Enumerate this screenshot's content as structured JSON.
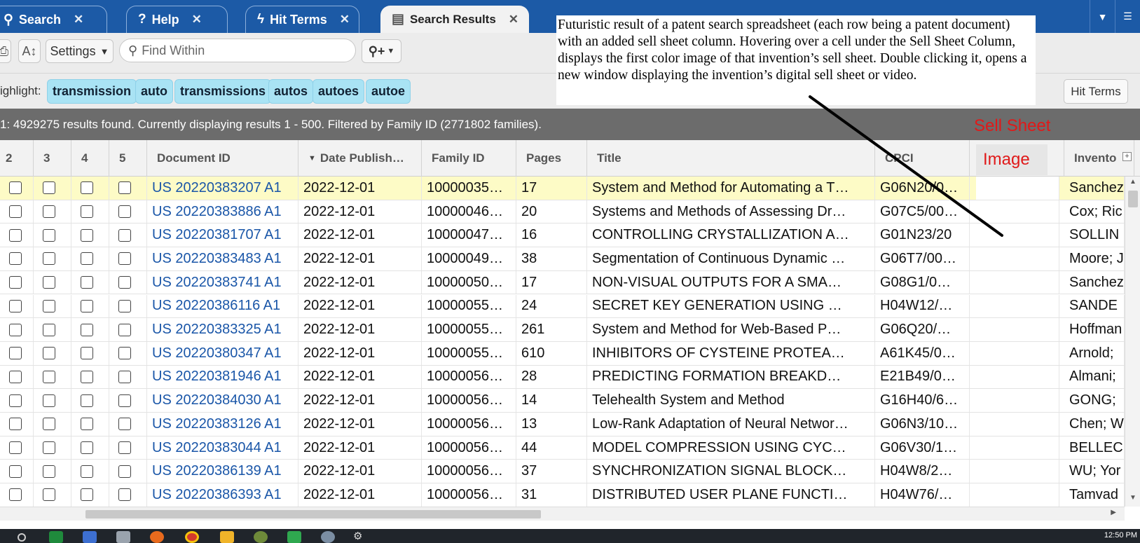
{
  "tabs": [
    {
      "label": "Search",
      "icon": "search-icon"
    },
    {
      "label": "Help",
      "icon": "help-icon"
    },
    {
      "label": "Hit Terms",
      "icon": "lightning-icon"
    },
    {
      "label": "Search Results",
      "icon": "results-icon",
      "active": true
    }
  ],
  "toolbar": {
    "settings_label": "Settings",
    "find_within_placeholder": "Find Within"
  },
  "highlight": {
    "label": "ighlight:",
    "terms": [
      "transmission",
      "auto",
      "transmissions",
      "autos",
      "autoes",
      "autoe"
    ],
    "hit_terms_button": "Hit Terms"
  },
  "status": {
    "text": "1: 4929275 results found. Currently displaying results 1 - 500. Filtered by Family ID (2771802 families)."
  },
  "annotation": {
    "text": "Futuristic result of a patent search spreadsheet (each row being a patent document) with an added sell sheet column. Hovering over a cell under the Sell Sheet Column, displays the first color image of that invention’s sell sheet.  Double clicking it, opens a new window displaying the invention’s digital sell sheet or video.",
    "sell_sheet_label": "Sell Sheet",
    "image_label": "Image"
  },
  "grid": {
    "columns": [
      "2",
      "3",
      "4",
      "5",
      "Document ID",
      "Date Publish…",
      "Family ID",
      "Pages",
      "Title",
      "CPCI",
      "",
      "Invento"
    ],
    "rows": [
      {
        "doc": "US 20220383207 A1",
        "date": "2022-12-01",
        "family": "10000035…",
        "pages": "17",
        "title": "System and Method for Automating a T…",
        "cpci": "G06N20/0…",
        "inventor": "Sanchez"
      },
      {
        "doc": "US 20220383886 A1",
        "date": "2022-12-01",
        "family": "10000046…",
        "pages": "20",
        "title": "Systems and Methods of Assessing Dr…",
        "cpci": "G07C5/00…",
        "inventor": "Cox; Ric"
      },
      {
        "doc": "US 20220381707 A1",
        "date": "2022-12-01",
        "family": "10000047…",
        "pages": "16",
        "title": "CONTROLLING CRYSTALLIZATION A…",
        "cpci": "G01N23/20",
        "inventor": "SOLLIN"
      },
      {
        "doc": "US 20220383483 A1",
        "date": "2022-12-01",
        "family": "10000049…",
        "pages": "38",
        "title": "Segmentation of Continuous Dynamic …",
        "cpci": "G06T7/00…",
        "inventor": "Moore; J"
      },
      {
        "doc": "US 20220383741 A1",
        "date": "2022-12-01",
        "family": "10000050…",
        "pages": "17",
        "title": "NON-VISUAL OUTPUTS FOR A SMA…",
        "cpci": "G08G1/0…",
        "inventor": "Sanchez"
      },
      {
        "doc": "US 20220386116 A1",
        "date": "2022-12-01",
        "family": "10000055…",
        "pages": "24",
        "title": "SECRET KEY GENERATION USING …",
        "cpci": "H04W12/…",
        "inventor": "SANDE"
      },
      {
        "doc": "US 20220383325 A1",
        "date": "2022-12-01",
        "family": "10000055…",
        "pages": "261",
        "title": "System and Method for Web-Based P…",
        "cpci": "G06Q20/…",
        "inventor": "Hoffman"
      },
      {
        "doc": "US 20220380347 A1",
        "date": "2022-12-01",
        "family": "10000055…",
        "pages": "610",
        "title": "INHIBITORS OF CYSTEINE PROTEA…",
        "cpci": "A61K45/0…",
        "inventor": "Arnold; "
      },
      {
        "doc": "US 20220381946 A1",
        "date": "2022-12-01",
        "family": "10000056…",
        "pages": "28",
        "title": "PREDICTING FORMATION BREAKD…",
        "cpci": "E21B49/0…",
        "inventor": "Almani;"
      },
      {
        "doc": "US 20220384030 A1",
        "date": "2022-12-01",
        "family": "10000056…",
        "pages": "14",
        "title": "Telehealth System and Method",
        "cpci": "G16H40/6…",
        "inventor": "GONG;"
      },
      {
        "doc": "US 20220383126 A1",
        "date": "2022-12-01",
        "family": "10000056…",
        "pages": "13",
        "title": "Low-Rank Adaptation of Neural Networ…",
        "cpci": "G06N3/10…",
        "inventor": "Chen; W"
      },
      {
        "doc": "US 20220383044 A1",
        "date": "2022-12-01",
        "family": "10000056…",
        "pages": "44",
        "title": "MODEL COMPRESSION USING CYC…",
        "cpci": "G06V30/1…",
        "inventor": "BELLEC"
      },
      {
        "doc": "US 20220386139 A1",
        "date": "2022-12-01",
        "family": "10000056…",
        "pages": "37",
        "title": "SYNCHRONIZATION SIGNAL BLOCK…",
        "cpci": "H04W8/2…",
        "inventor": "WU; Yor"
      },
      {
        "doc": "US 20220386393 A1",
        "date": "2022-12-01",
        "family": "10000056…",
        "pages": "31",
        "title": "DISTRIBUTED USER PLANE FUNCTI…",
        "cpci": "H04W76/…",
        "inventor": "Tamvad"
      }
    ]
  },
  "taskbar": {
    "clock": "12:50 PM"
  },
  "colors": {
    "tabbar": "#1c5aa6",
    "chip": "#a9e3f4",
    "selected_row": "#fdfbc6",
    "link": "#1a56a8",
    "annotation_red": "#e01919"
  }
}
